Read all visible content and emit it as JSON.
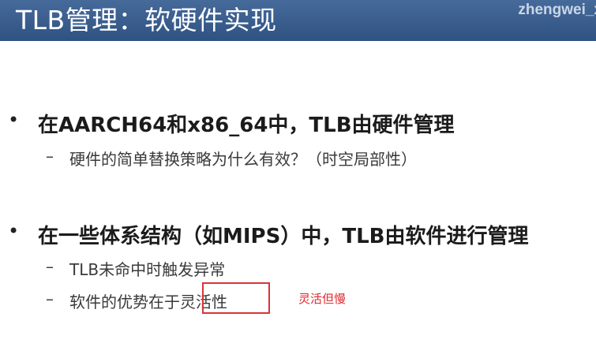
{
  "slide": {
    "title": "TLB管理：软硬件实现",
    "watermark": "zhengwei_x"
  },
  "bullets": [
    {
      "marker": "•",
      "text": "在AARCH64和x86_64中，TLB由硬件管理",
      "subitems": [
        {
          "marker": "–",
          "text": "硬件的简单替换策略为什么有效？（时空局部性）"
        }
      ]
    },
    {
      "marker": "•",
      "text": "在一些体系结构（如MIPS）中，TLB由软件进行管理",
      "subitems": [
        {
          "marker": "–",
          "text": "TLB未命中时触发异常"
        },
        {
          "marker": "–",
          "text": "软件的优势在于灵活性"
        }
      ]
    }
  ],
  "annotation": {
    "note": "灵活但慢",
    "box_color": "#d9343a",
    "note_color": "#e0282e"
  },
  "colors": {
    "header": "#3a5d8f",
    "text": "#1b1b1b"
  }
}
